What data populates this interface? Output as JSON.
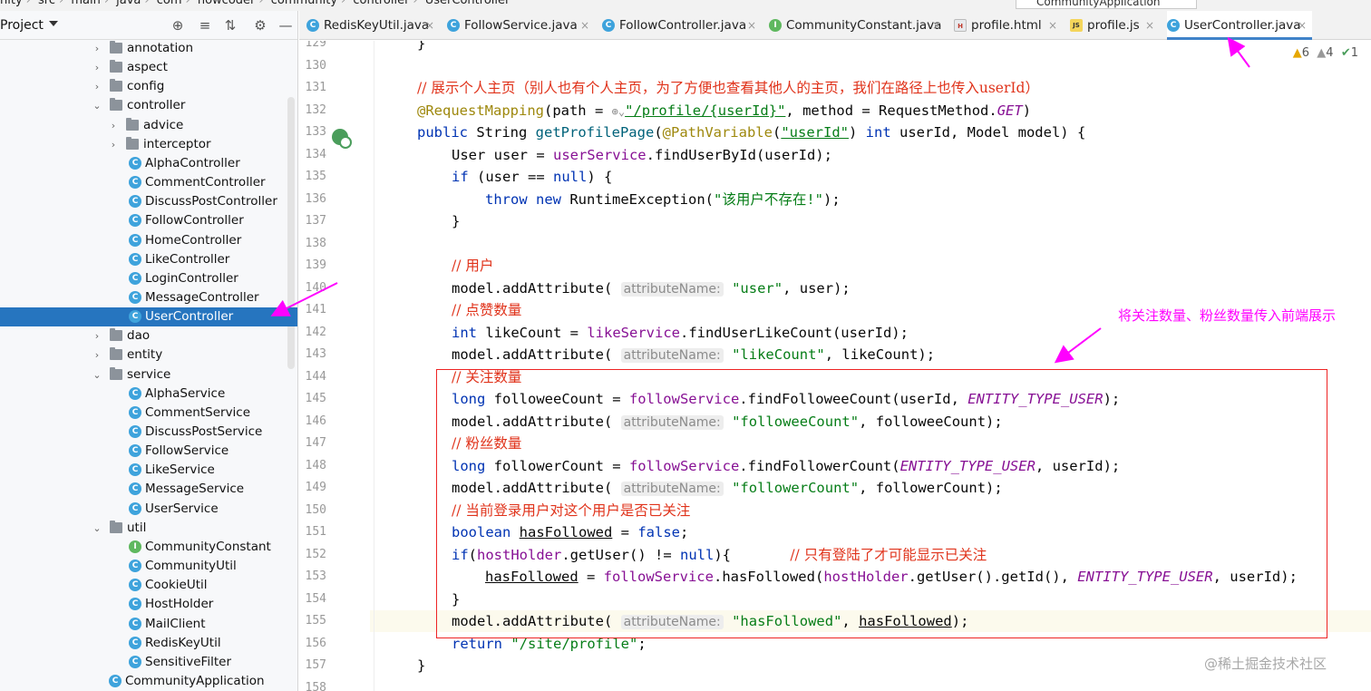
{
  "breadcrumb": [
    "nity",
    "src",
    "main",
    "java",
    "com",
    "nowcoder",
    "community",
    "controller",
    "UserController"
  ],
  "run_config": "CommunityApplication",
  "project_panel": {
    "title": "Project",
    "tree": [
      {
        "label": "annotation",
        "type": "folder",
        "expanded": false
      },
      {
        "label": "aspect",
        "type": "folder",
        "expanded": false
      },
      {
        "label": "config",
        "type": "folder",
        "expanded": false
      },
      {
        "label": "controller",
        "type": "folder",
        "expanded": true
      },
      {
        "label": "advice",
        "type": "folder",
        "expanded": false
      },
      {
        "label": "interceptor",
        "type": "folder",
        "expanded": false
      },
      {
        "label": "AlphaController",
        "type": "class"
      },
      {
        "label": "CommentController",
        "type": "class"
      },
      {
        "label": "DiscussPostController",
        "type": "class"
      },
      {
        "label": "FollowController",
        "type": "class"
      },
      {
        "label": "HomeController",
        "type": "class"
      },
      {
        "label": "LikeController",
        "type": "class"
      },
      {
        "label": "LoginController",
        "type": "class"
      },
      {
        "label": "MessageController",
        "type": "class"
      },
      {
        "label": "UserController",
        "type": "class",
        "selected": true
      },
      {
        "label": "dao",
        "type": "folder",
        "expanded": false
      },
      {
        "label": "entity",
        "type": "folder",
        "expanded": false
      },
      {
        "label": "service",
        "type": "folder",
        "expanded": true
      },
      {
        "label": "AlphaService",
        "type": "class"
      },
      {
        "label": "CommentService",
        "type": "class"
      },
      {
        "label": "DiscussPostService",
        "type": "class"
      },
      {
        "label": "FollowService",
        "type": "class"
      },
      {
        "label": "LikeService",
        "type": "class"
      },
      {
        "label": "MessageService",
        "type": "class"
      },
      {
        "label": "UserService",
        "type": "class"
      },
      {
        "label": "util",
        "type": "folder",
        "expanded": true
      },
      {
        "label": "CommunityConstant",
        "type": "interface"
      },
      {
        "label": "CommunityUtil",
        "type": "class"
      },
      {
        "label": "CookieUtil",
        "type": "class"
      },
      {
        "label": "HostHolder",
        "type": "class"
      },
      {
        "label": "MailClient",
        "type": "class"
      },
      {
        "label": "RedisKeyUtil",
        "type": "class"
      },
      {
        "label": "SensitiveFilter",
        "type": "class"
      },
      {
        "label": "CommunityApplication",
        "type": "app"
      }
    ]
  },
  "tabs": [
    {
      "label": "RedisKeyUtil.java",
      "icon": "class-icon"
    },
    {
      "label": "FollowService.java",
      "icon": "class-icon"
    },
    {
      "label": "FollowController.java",
      "icon": "class-icon"
    },
    {
      "label": "CommunityConstant.java",
      "icon": "interface-icon"
    },
    {
      "label": "profile.html",
      "icon": "html-file-icon"
    },
    {
      "label": "profile.js",
      "icon": "js-file-icon"
    },
    {
      "label": "UserController.java",
      "icon": "class-icon",
      "active": true
    }
  ],
  "inspections": {
    "warnings": "6",
    "weak_warnings": "4",
    "typos": "1"
  },
  "line_numbers": [
    "129",
    "130",
    "131",
    "132",
    "133",
    "134",
    "135",
    "136",
    "137",
    "138",
    "139",
    "140",
    "141",
    "142",
    "143",
    "144",
    "145",
    "146",
    "147",
    "148",
    "149",
    "150",
    "151",
    "152",
    "153",
    "154",
    "155",
    "156",
    "157",
    "158"
  ],
  "code": {
    "l129": "}",
    "l131_comment": "// 展示个人主页（别人也有个人主页，为了方便也查看其他人的主页，我们在路径上也传入userId）",
    "l132_annotation": "@RequestMapping",
    "l132_a": "(path = ",
    "l132_path": "\"/profile/{userId}\"",
    "l132_b": ", method = RequestMethod.",
    "l132_get": "GET",
    "l132_c": ")",
    "l133_public": "public",
    "l133_a": " String ",
    "l133_method": "getProfilePage",
    "l133_b": "(",
    "l133_pv": "@PathVariable",
    "l133_c": "(",
    "l133_str": "\"userId\"",
    "l133_d": ") ",
    "l133_int": "int",
    "l133_e": " userId, Model model) {",
    "l134_a": "User user = ",
    "l134_field": "userService",
    "l134_b": ".findUserById(userId);",
    "l135_if": "if",
    "l135_a": " (user == ",
    "l135_null": "null",
    "l135_b": ") {",
    "l136_throw": "throw",
    "l136_new": "new",
    "l136_a": " RuntimeException(",
    "l136_str": "\"该用户不存在!\"",
    "l136_b": ");",
    "l137": "}",
    "l139_comment": "// 用户",
    "l140_a": "model.addAttribute(",
    "l140_hint": "attributeName:",
    "l140_str": "\"user\"",
    "l140_b": ", user);",
    "l141_comment": "// 点赞数量",
    "l142_int": "int",
    "l142_a": " likeCount = ",
    "l142_field": "likeService",
    "l142_b": ".findUserLikeCount(userId);",
    "l143_a": "model.addAttribute(",
    "l143_hint": "attributeName:",
    "l143_str": "\"likeCount\"",
    "l143_b": ", likeCount);",
    "l144_comment": "// 关注数量",
    "l145_long": "long",
    "l145_a": " followeeCount = ",
    "l145_field": "followService",
    "l145_b": ".findFolloweeCount(userId, ",
    "l145_const": "ENTITY_TYPE_USER",
    "l145_c": ");",
    "l146_a": "model.addAttribute(",
    "l146_hint": "attributeName:",
    "l146_str": "\"followeeCount\"",
    "l146_b": ", followeeCount);",
    "l147_comment": "// 粉丝数量",
    "l148_long": "long",
    "l148_a": " followerCount = ",
    "l148_field": "followService",
    "l148_b": ".findFollowerCount(",
    "l148_const": "ENTITY_TYPE_USER",
    "l148_c": ", userId);",
    "l149_a": "model.addAttribute(",
    "l149_hint": "attributeName:",
    "l149_str": "\"followerCount\"",
    "l149_b": ", followerCount);",
    "l150_comment": "// 当前登录用户对这个用户是否已关注",
    "l151_boolean": "boolean",
    "l151_sp": " ",
    "l151_var": "hasFollowed",
    "l151_a": " = ",
    "l151_false": "false",
    "l151_b": ";",
    "l152_if": "if",
    "l152_a": "(",
    "l152_field": "hostHolder",
    "l152_b": ".getUser() != ",
    "l152_null": "null",
    "l152_c": "){       ",
    "l152_comment": "// 只有登陆了才可能显示已关注",
    "l153_var": "hasFollowed",
    "l153_a": " = ",
    "l153_field": "followService",
    "l153_b": ".hasFollowed(",
    "l153_field2": "hostHolder",
    "l153_c": ".getUser().getId(), ",
    "l153_const": "ENTITY_TYPE_USER",
    "l153_d": ", userId);",
    "l154": "}",
    "l155_a": "model.addAttribute(",
    "l155_hint": "attributeName:",
    "l155_str": "\"hasFollowed\"",
    "l155_b": ", ",
    "l155_var": "hasFollowed",
    "l155_c": ");",
    "l156_return": "return",
    "l156_str": " \"/site/profile\"",
    "l156_b": ";",
    "l157": "}"
  },
  "annotation_note": "将关注数量、粉丝数量传入前端展示",
  "watermark": "@稀土掘金技术社区",
  "colors": {
    "selection": "#2675bf",
    "keyword": "#0033b3",
    "comment": "#e0331b",
    "string": "#067d17",
    "annotation_box": "#ee2424",
    "arrow": "#ff00ff"
  }
}
